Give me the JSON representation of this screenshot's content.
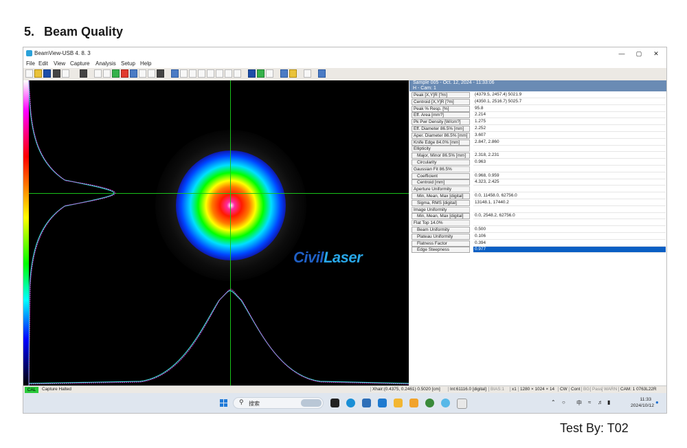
{
  "document": {
    "heading_number": "5.",
    "heading_text": "Beam Quality",
    "test_by": "Test By: T02"
  },
  "window": {
    "title": "BeamView-USB 4. 8. 3",
    "controls": [
      "—",
      "▢",
      "✕"
    ]
  },
  "menu": [
    "File",
    "Edit",
    "View",
    "Capture",
    "Analysis",
    "Setup",
    "Help"
  ],
  "watermark": {
    "part1": "Civil",
    "part2": "Laser"
  },
  "results": {
    "header_line1": "Sample 005 - Oct. 12, 2024 - 11:33:06",
    "header_line2": "H - Cam: 1",
    "rows": [
      {
        "label": "Peak [X,Y]R [?m]",
        "value": "(4379.5, 2457.4) 5021.9",
        "kind": "normal"
      },
      {
        "label": "Centroid [X,Y]R [?m]",
        "value": "(4350.1, 2516.7) 5025.7",
        "kind": "normal"
      },
      {
        "label": "Peak % Resp. [%]",
        "value": "95.8",
        "kind": "normal"
      },
      {
        "label": "Eff. Area [mm?]",
        "value": "2.214",
        "kind": "normal"
      },
      {
        "label": "Pk Pwr Density [W/cm?]",
        "value": "1.275",
        "kind": "normal"
      },
      {
        "label": "Eff. Diameter 86.5% [mm]",
        "value": "2.252",
        "kind": "normal"
      },
      {
        "label": "Aper. Diameter 86.5% [mm]",
        "value": "3.607",
        "kind": "normal"
      },
      {
        "label": "Knife Edge 84.0% [mm]",
        "value": "2.847, 2.860",
        "kind": "normal"
      },
      {
        "label": "Ellipticity",
        "value": "",
        "kind": "section"
      },
      {
        "label": "Major, Minor 86.5% [mm]",
        "value": "2.318, 2.231",
        "kind": "sub"
      },
      {
        "label": "Circularity",
        "value": "0.963",
        "kind": "sub"
      },
      {
        "label": "Gaussian Fit 86.5%",
        "value": "",
        "kind": "section"
      },
      {
        "label": "Coefficient",
        "value": "0.968, 0.959",
        "kind": "sub"
      },
      {
        "label": "Centroid [mm]",
        "value": "4.323, 2.425",
        "kind": "sub"
      },
      {
        "label": "Aperture Uniformity",
        "value": "",
        "kind": "section"
      },
      {
        "label": "Min, Mean, Max [digital]",
        "value": "0.0, 11458.0, 62756.0",
        "kind": "sub"
      },
      {
        "label": "Sigma, RMS [digital]",
        "value": "13148.1, 17440.2",
        "kind": "sub"
      },
      {
        "label": "Image Uniformity",
        "value": "",
        "kind": "section"
      },
      {
        "label": "Min, Mean, Max [digital]",
        "value": "0.0, 2548.2, 62756.0",
        "kind": "sub"
      },
      {
        "label": "Flat Top 14.0%",
        "value": "",
        "kind": "section"
      },
      {
        "label": "Beam Uniformity",
        "value": "0.500",
        "kind": "sub"
      },
      {
        "label": "Plateau Uniformity",
        "value": "0.106",
        "kind": "sub"
      },
      {
        "label": "Flatness Factor",
        "value": "0.394",
        "kind": "sub"
      },
      {
        "label": "Edge Steepness",
        "value": "0.977",
        "kind": "sub-selected"
      }
    ]
  },
  "status": {
    "cal": "CAL",
    "capture_state": "Capture Halted",
    "xhair": "Xhair:(0.4375, 0.2461) 0.5020 [cm]",
    "intensity": "Int:61116.0 [digital]",
    "bias": "BIAS:1",
    "zoom": "x1",
    "resolution": "1280 × 1024 × 14",
    "cw": "CW",
    "cont": "Cont",
    "bg": "BG",
    "pass": "Pass",
    "warn": "WARN",
    "cam": "CAM: 1 0763L22R"
  },
  "taskbar": {
    "search_placeholder": "搜索",
    "ime": "中",
    "time": "11:33",
    "date": "2024/10/12"
  }
}
